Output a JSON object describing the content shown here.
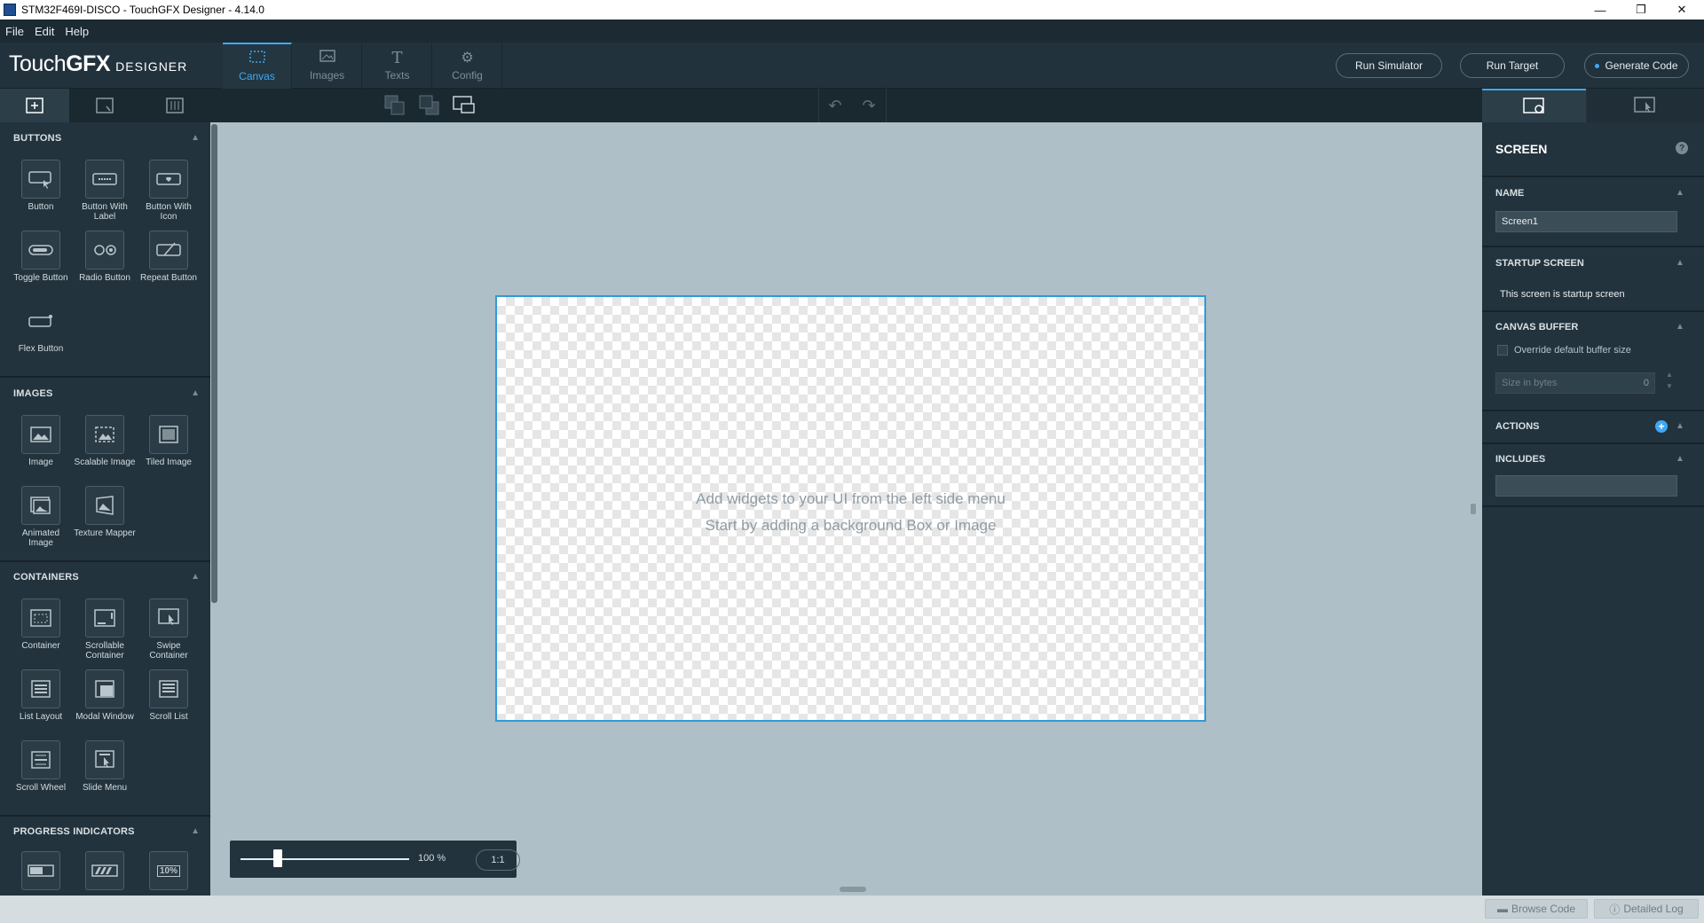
{
  "window": {
    "title": "STM32F469I-DISCO - TouchGFX Designer - 4.14.0",
    "controls": [
      "—",
      "❐",
      "✕"
    ]
  },
  "menubar": {
    "items": [
      "File",
      "Edit",
      "Help"
    ]
  },
  "header": {
    "logo": {
      "touch": "Touch",
      "gfx": "GFX",
      "designer": "DESIGNER"
    },
    "tabs": [
      {
        "label": "Canvas",
        "icon": "canvas-icon"
      },
      {
        "label": "Images",
        "icon": "images-icon"
      },
      {
        "label": "Texts",
        "icon": "texts-icon"
      },
      {
        "label": "Config",
        "icon": "config-icon"
      }
    ],
    "buttons": {
      "run_simulator": "Run Simulator",
      "run_target": "Run Target",
      "generate_code": "Generate Code"
    }
  },
  "left_panel": {
    "sections": {
      "buttons": {
        "title": "BUTTONS",
        "items": [
          "Button",
          "Button With Label",
          "Button With Icon",
          "Toggle Button",
          "Radio Button",
          "Repeat Button",
          "Flex Button"
        ]
      },
      "images": {
        "title": "IMAGES",
        "items": [
          "Image",
          "Scalable Image",
          "Tiled Image",
          "Animated Image",
          "Texture Mapper"
        ]
      },
      "containers": {
        "title": "CONTAINERS",
        "items": [
          "Container",
          "Scrollable Container",
          "Swipe Container",
          "List Layout",
          "Modal Window",
          "Scroll List",
          "Scroll Wheel",
          "Slide Menu"
        ]
      },
      "progress": {
        "title": "PROGRESS INDICATORS",
        "percent_label": "10%"
      }
    }
  },
  "canvas": {
    "hint_line1": "Add widgets to your UI from the left side menu",
    "hint_line2": "Start by adding a background Box or Image",
    "zoom_value": "100 %",
    "zoom_fraction": 0.22,
    "zoom_reset": "1:1"
  },
  "right_panel": {
    "title": "SCREEN",
    "help": "?",
    "name_label": "NAME",
    "name_value": "Screen1",
    "startup_label": "STARTUP SCREEN",
    "startup_text": "This screen is startup screen",
    "canvas_buffer_label": "CANVAS BUFFER",
    "override_label": "Override default buffer size",
    "size_placeholder": "Size in bytes",
    "size_value": "0",
    "actions_label": "ACTIONS",
    "includes_label": "INCLUDES"
  },
  "statusbar": {
    "browse_code": "Browse Code",
    "detailed_log": "Detailed Log"
  },
  "colors": {
    "accent": "#3fa9f5",
    "panel": "#23333d",
    "canvas_bg": "#aebfc7"
  }
}
